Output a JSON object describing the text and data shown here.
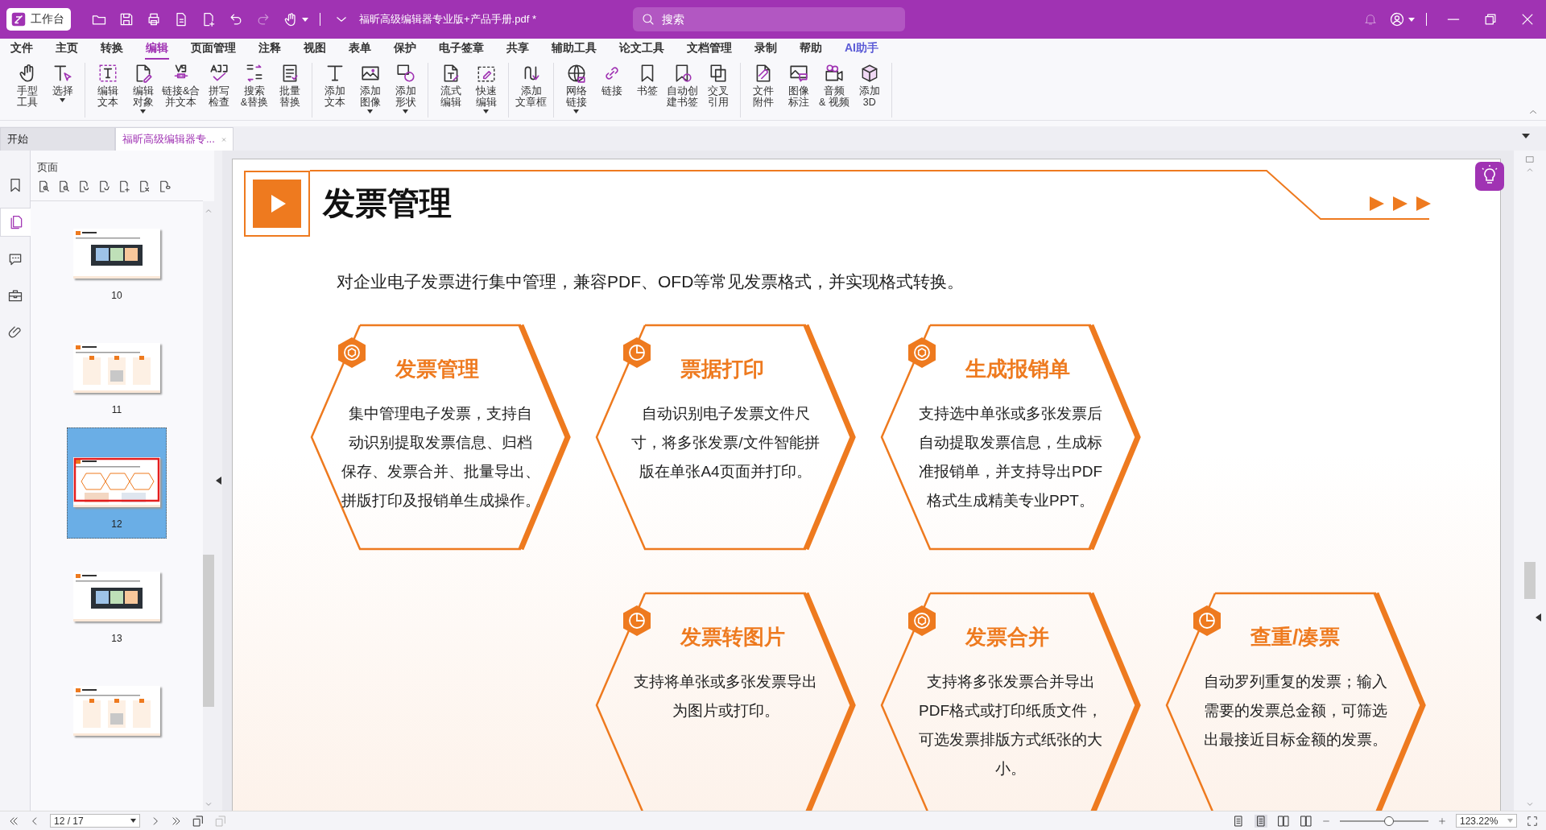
{
  "window": {
    "app_button": "工作台",
    "title": "福昕高级编辑器专业版+产品手册.pdf *",
    "search": {
      "placeholder": "搜索"
    }
  },
  "menu": [
    {
      "label": "文件",
      "kind": "plain",
      "selected": false
    },
    {
      "label": "主页",
      "kind": "plain",
      "selected": false
    },
    {
      "label": "转换",
      "kind": "plain",
      "selected": false
    },
    {
      "label": "编辑",
      "kind": "plain",
      "selected": true
    },
    {
      "label": "页面管理",
      "kind": "plain",
      "selected": false
    },
    {
      "label": "注释",
      "kind": "plain",
      "selected": false
    },
    {
      "label": "视图",
      "kind": "plain",
      "selected": false
    },
    {
      "label": "表单",
      "kind": "plain",
      "selected": false
    },
    {
      "label": "保护",
      "kind": "plain",
      "selected": false
    },
    {
      "label": "电子签章",
      "kind": "plain",
      "selected": false
    },
    {
      "label": "共享",
      "kind": "plain",
      "selected": false
    },
    {
      "label": "辅助工具",
      "kind": "plain",
      "selected": false
    },
    {
      "label": "论文工具",
      "kind": "plain",
      "selected": false
    },
    {
      "label": "文档管理",
      "kind": "plain",
      "selected": false
    },
    {
      "label": "录制",
      "kind": "plain",
      "selected": false
    },
    {
      "label": "帮助",
      "kind": "plain",
      "selected": false
    },
    {
      "label": "AI助手",
      "kind": "ai",
      "selected": false
    }
  ],
  "ribbon": [
    [
      {
        "lines": [
          "手型",
          "工具"
        ],
        "dropdown": false
      },
      {
        "lines": [
          "选择"
        ],
        "dropdown": true
      }
    ],
    [
      {
        "lines": [
          "编辑",
          "文本"
        ],
        "dropdown": false
      },
      {
        "lines": [
          "编辑",
          "对象"
        ],
        "dropdown": true
      },
      {
        "lines": [
          "链接&合",
          "并文本"
        ],
        "dropdown": false
      },
      {
        "lines": [
          "拼写",
          "检查"
        ],
        "dropdown": false
      },
      {
        "lines": [
          "搜索",
          "&替换"
        ],
        "dropdown": false
      },
      {
        "lines": [
          "批量",
          "替换"
        ],
        "dropdown": false
      }
    ],
    [
      {
        "lines": [
          "添加",
          "文本"
        ],
        "dropdown": false
      },
      {
        "lines": [
          "添加",
          "图像"
        ],
        "dropdown": true
      },
      {
        "lines": [
          "添加",
          "形状"
        ],
        "dropdown": true
      }
    ],
    [
      {
        "lines": [
          "流式",
          "编辑"
        ],
        "dropdown": false
      },
      {
        "lines": [
          "快速",
          "编辑"
        ],
        "dropdown": true
      }
    ],
    [
      {
        "lines": [
          "添加",
          "文章框"
        ],
        "dropdown": false
      }
    ],
    [
      {
        "lines": [
          "网络",
          "链接"
        ],
        "dropdown": true
      },
      {
        "lines": [
          "链接"
        ],
        "dropdown": false
      },
      {
        "lines": [
          "书签"
        ],
        "dropdown": false
      },
      {
        "lines": [
          "自动创",
          "建书签"
        ],
        "dropdown": false
      },
      {
        "lines": [
          "交叉",
          "引用"
        ],
        "dropdown": false
      }
    ],
    [
      {
        "lines": [
          "文件",
          "附件"
        ],
        "dropdown": false
      },
      {
        "lines": [
          "图像",
          "标注"
        ],
        "dropdown": false
      },
      {
        "lines": [
          "音频",
          "& 视频"
        ],
        "dropdown": false
      },
      {
        "lines": [
          "添加",
          "3D"
        ],
        "dropdown": false
      }
    ]
  ],
  "tabs": [
    {
      "label": "开始",
      "selected": false,
      "closable": false
    },
    {
      "label": "福昕高级编辑器专...",
      "selected": true,
      "closable": true
    }
  ],
  "sidebar": {
    "tabs": [
      {
        "selected": false
      },
      {
        "selected": true
      },
      {
        "selected": false
      },
      {
        "selected": false
      },
      {
        "selected": false
      }
    ],
    "panel_title": "页面",
    "thumbnails": [
      {
        "number": "10",
        "selected": false
      },
      {
        "number": "11",
        "selected": false
      },
      {
        "number": "12",
        "selected": true
      },
      {
        "number": "13",
        "selected": false
      },
      {
        "selected": false
      }
    ]
  },
  "document": {
    "heading": "发票管理",
    "intro": "对企业电子发票进行集中管理，兼容PDF、OFD等常见发票格式，并实现格式转换。",
    "cards": [
      {
        "title": "发票管理",
        "text_lines": [
          "集中管理电子发票，支持自",
          "动识别提取发票信息、归档",
          "保存、发票合并、批量导出、",
          "拼版打印及报销单生成操作。"
        ]
      },
      {
        "title": "票据打印",
        "text_lines": [
          "自动识别电子发票文件尺",
          "寸，将多张发票/文件智能拼",
          "版在单张A4页面并打印。"
        ]
      },
      {
        "title": "生成报销单",
        "text_lines": [
          "支持选中单张或多张发票后",
          "自动提取发票信息，生成标",
          "准报销单，并支持导出PDF",
          "格式生成精美专业PPT。"
        ]
      },
      {
        "title": "发票转图片",
        "text_lines": [
          "支持将单张或多张发票导出",
          "为图片或打印。"
        ]
      },
      {
        "title": "发票合并",
        "text_lines": [
          "支持将多张发票合并导出",
          "PDF格式或打印纸质文件，",
          "可选发票排版方式纸张的大",
          "小。"
        ]
      },
      {
        "title": "查重/凑票",
        "text_lines": [
          "自动罗列重复的发票；输入",
          "需要的发票总金额，可筛选",
          "出最接近目标金额的发票。"
        ]
      }
    ]
  },
  "status_bar": {
    "page_field": "12 / 17",
    "zoom": {
      "value": "123.22%",
      "level": 0.55
    }
  }
}
